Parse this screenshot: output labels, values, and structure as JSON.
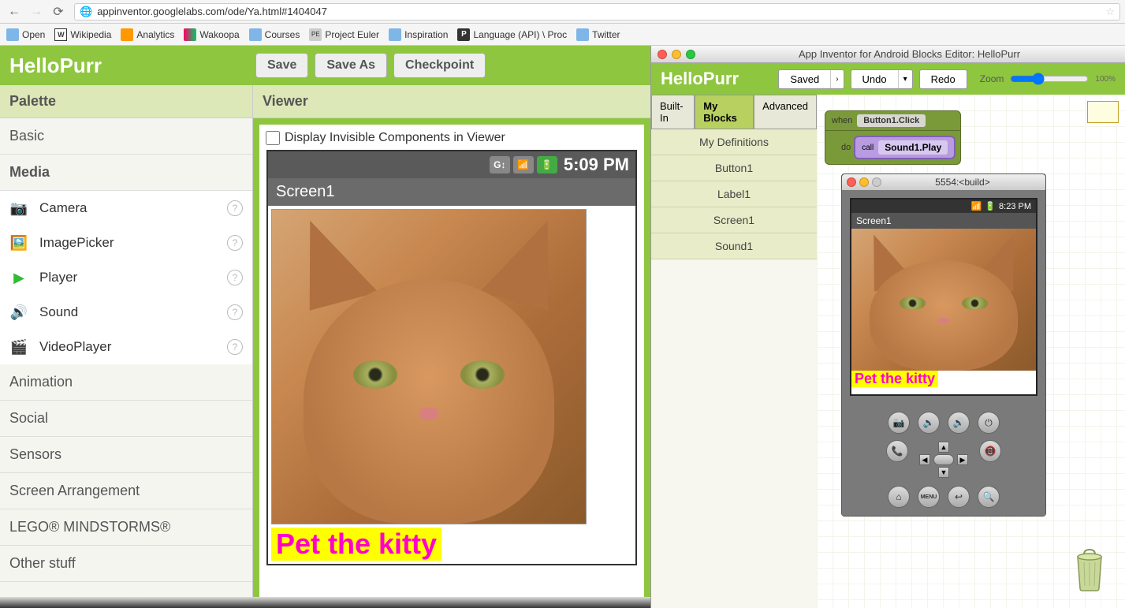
{
  "browser": {
    "url": "appinventor.googlelabs.com/ode/Ya.html#1404047",
    "bookmarks": [
      "Open",
      "Wikipedia",
      "Analytics",
      "Wakoopa",
      "Courses",
      "Project Euler",
      "Inspiration",
      "Language (API) \\ Proc",
      "Twitter"
    ]
  },
  "designer": {
    "project": "HelloPurr",
    "buttons": {
      "save": "Save",
      "save_as": "Save As",
      "checkpoint": "Checkpoint"
    },
    "palette_title": "Palette",
    "viewer_title": "Viewer",
    "categories": {
      "basic": "Basic",
      "media": "Media",
      "animation": "Animation",
      "social": "Social",
      "sensors": "Sensors",
      "screen": "Screen Arrangement",
      "lego": "LEGO® MINDSTORMS®",
      "other": "Other stuff"
    },
    "media_items": [
      "Camera",
      "ImagePicker",
      "Player",
      "Sound",
      "VideoPlayer"
    ],
    "viewer_checkbox_label": "Display Invisible Components in Viewer",
    "phone": {
      "time": "5:09 PM",
      "screen_title": "Screen1",
      "label_text": "Pet the kitty"
    }
  },
  "blocks": {
    "window_title": "App Inventor for Android Blocks Editor: HelloPurr",
    "project": "HelloPurr",
    "toolbar": {
      "saved": "Saved",
      "undo": "Undo",
      "redo": "Redo",
      "zoom": "Zoom",
      "zoom_pct": "100%"
    },
    "tabs": {
      "builtin": "Built-In",
      "myblocks": "My Blocks",
      "advanced": "Advanced"
    },
    "drawers": [
      "My Definitions",
      "Button1",
      "Label1",
      "Screen1",
      "Sound1"
    ],
    "when_block": {
      "keyword": "when",
      "event": "Button1.Click",
      "do": "do"
    },
    "call_block": {
      "keyword": "call",
      "method": "Sound1.Play"
    }
  },
  "emulator": {
    "title": "5554:<build>",
    "time": "8:23 PM",
    "screen_title": "Screen1",
    "label_text": "Pet the kitty",
    "hw": {
      "menu": "MENU"
    }
  }
}
